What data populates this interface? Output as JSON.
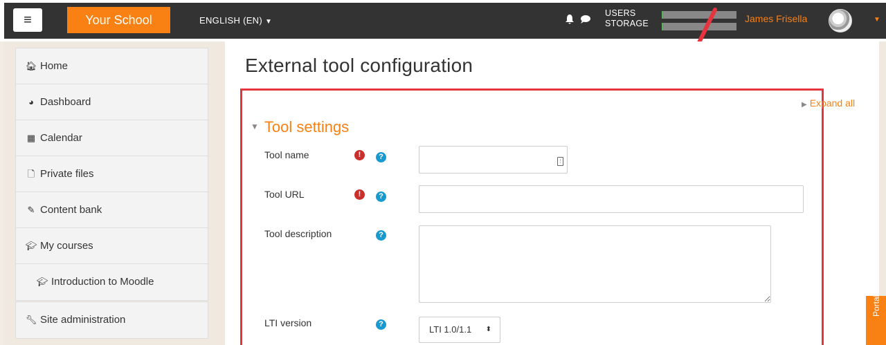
{
  "header": {
    "menu_icon": "hamburger-icon",
    "brand": "Your School",
    "language": "ENGLISH (EN)",
    "quota": {
      "users_label": "USERS",
      "storage_label": "STORAGE",
      "users_fill": 0.01,
      "storage_fill": 0.01
    },
    "user_name": "James Frisella"
  },
  "sidebar": {
    "items": [
      {
        "label": "Home",
        "icon": "home-icon"
      },
      {
        "label": "Dashboard",
        "icon": "dashboard-icon"
      },
      {
        "label": "Calendar",
        "icon": "calendar-icon"
      },
      {
        "label": "Private files",
        "icon": "file-icon"
      },
      {
        "label": "Content bank",
        "icon": "brush-icon"
      },
      {
        "label": "My courses",
        "icon": "graduation-cap-icon"
      },
      {
        "label": "Introduction to Moodle",
        "icon": "graduation-cap-icon"
      }
    ],
    "admin": {
      "label": "Site administration",
      "icon": "wrench-icon"
    }
  },
  "main": {
    "title": "External tool configuration",
    "expand_all": "Expand all",
    "section_title": "Tool settings",
    "fields": {
      "tool_name": {
        "label": "Tool name",
        "value": ""
      },
      "tool_url": {
        "label": "Tool URL",
        "value": ""
      },
      "tool_description": {
        "label": "Tool description",
        "value": ""
      },
      "lti_version": {
        "label": "LTI version",
        "value": "LTI 1.0/1.1"
      }
    }
  },
  "portal_tab": "Portal",
  "colors": {
    "brand": "#f98012",
    "navbar": "#333333",
    "highlight": "#e5343e",
    "required": "#c9302c",
    "help": "#1899d0"
  }
}
